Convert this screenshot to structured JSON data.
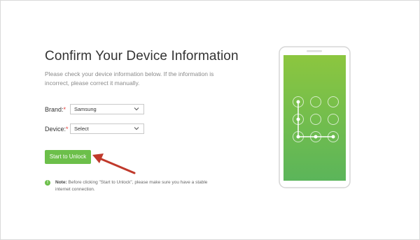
{
  "page": {
    "title": "Confirm Your Device Information",
    "description": "Please check your device information below. If the information is incorrect, please correct it manually."
  },
  "form": {
    "brand": {
      "label": "Brand:",
      "required_mark": "*",
      "value": "Samsung"
    },
    "device": {
      "label": "Device:",
      "required_mark": "*",
      "value": "Select"
    }
  },
  "actions": {
    "start_unlock_label": "Start to Unlock"
  },
  "note": {
    "icon": "info-icon",
    "prefix": "Note:",
    "text": " Before clicking \"Start to Unlock\", please make sure you have a stable internet connection."
  },
  "colors": {
    "accent": "#6cbf4a",
    "arrow": "#c0392b",
    "screen_top": "#8cc63f",
    "screen_bottom": "#5bb55a"
  }
}
